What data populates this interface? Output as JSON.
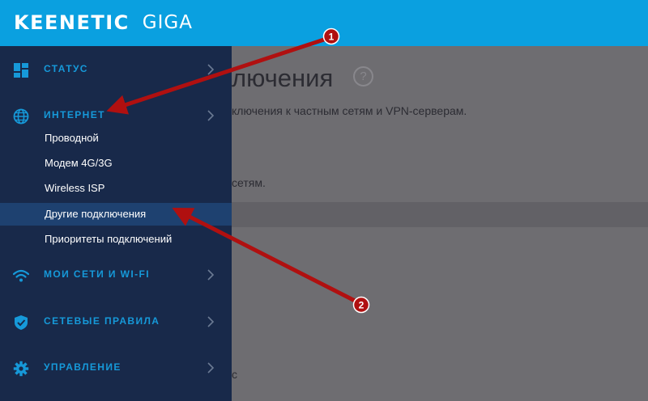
{
  "header": {
    "brand": "KEENETIC",
    "model": "GIGA"
  },
  "sidebar": {
    "items": [
      {
        "label": "СТАТУС",
        "icon": "dashboard-icon"
      },
      {
        "label": "ИНТЕРНЕТ",
        "icon": "globe-icon",
        "sub": [
          "Проводной",
          "Модем 4G/3G",
          "Wireless ISP",
          "Другие подключения",
          "Приоритеты подключений"
        ]
      },
      {
        "label": "МОИ СЕТИ И WI-FI",
        "icon": "wifi-icon"
      },
      {
        "label": "СЕТЕВЫЕ ПРАВИЛА",
        "icon": "shield-icon"
      },
      {
        "label": "УПРАВЛЕНИЕ",
        "icon": "gear-icon"
      }
    ],
    "active_sub": "Другие подключения"
  },
  "content": {
    "title": "лючения",
    "help": "?",
    "description": "ключения к частным сетям и VPN-серверам.",
    "description2": "сетям.",
    "description3": "с"
  },
  "annotations": {
    "marker1": "1",
    "marker2": "2",
    "arrow_color": "#b01010"
  },
  "colors": {
    "header": "#0aa0e0",
    "sidebar": "#18294a",
    "accent": "#1699d9",
    "active": "#1e4170"
  }
}
